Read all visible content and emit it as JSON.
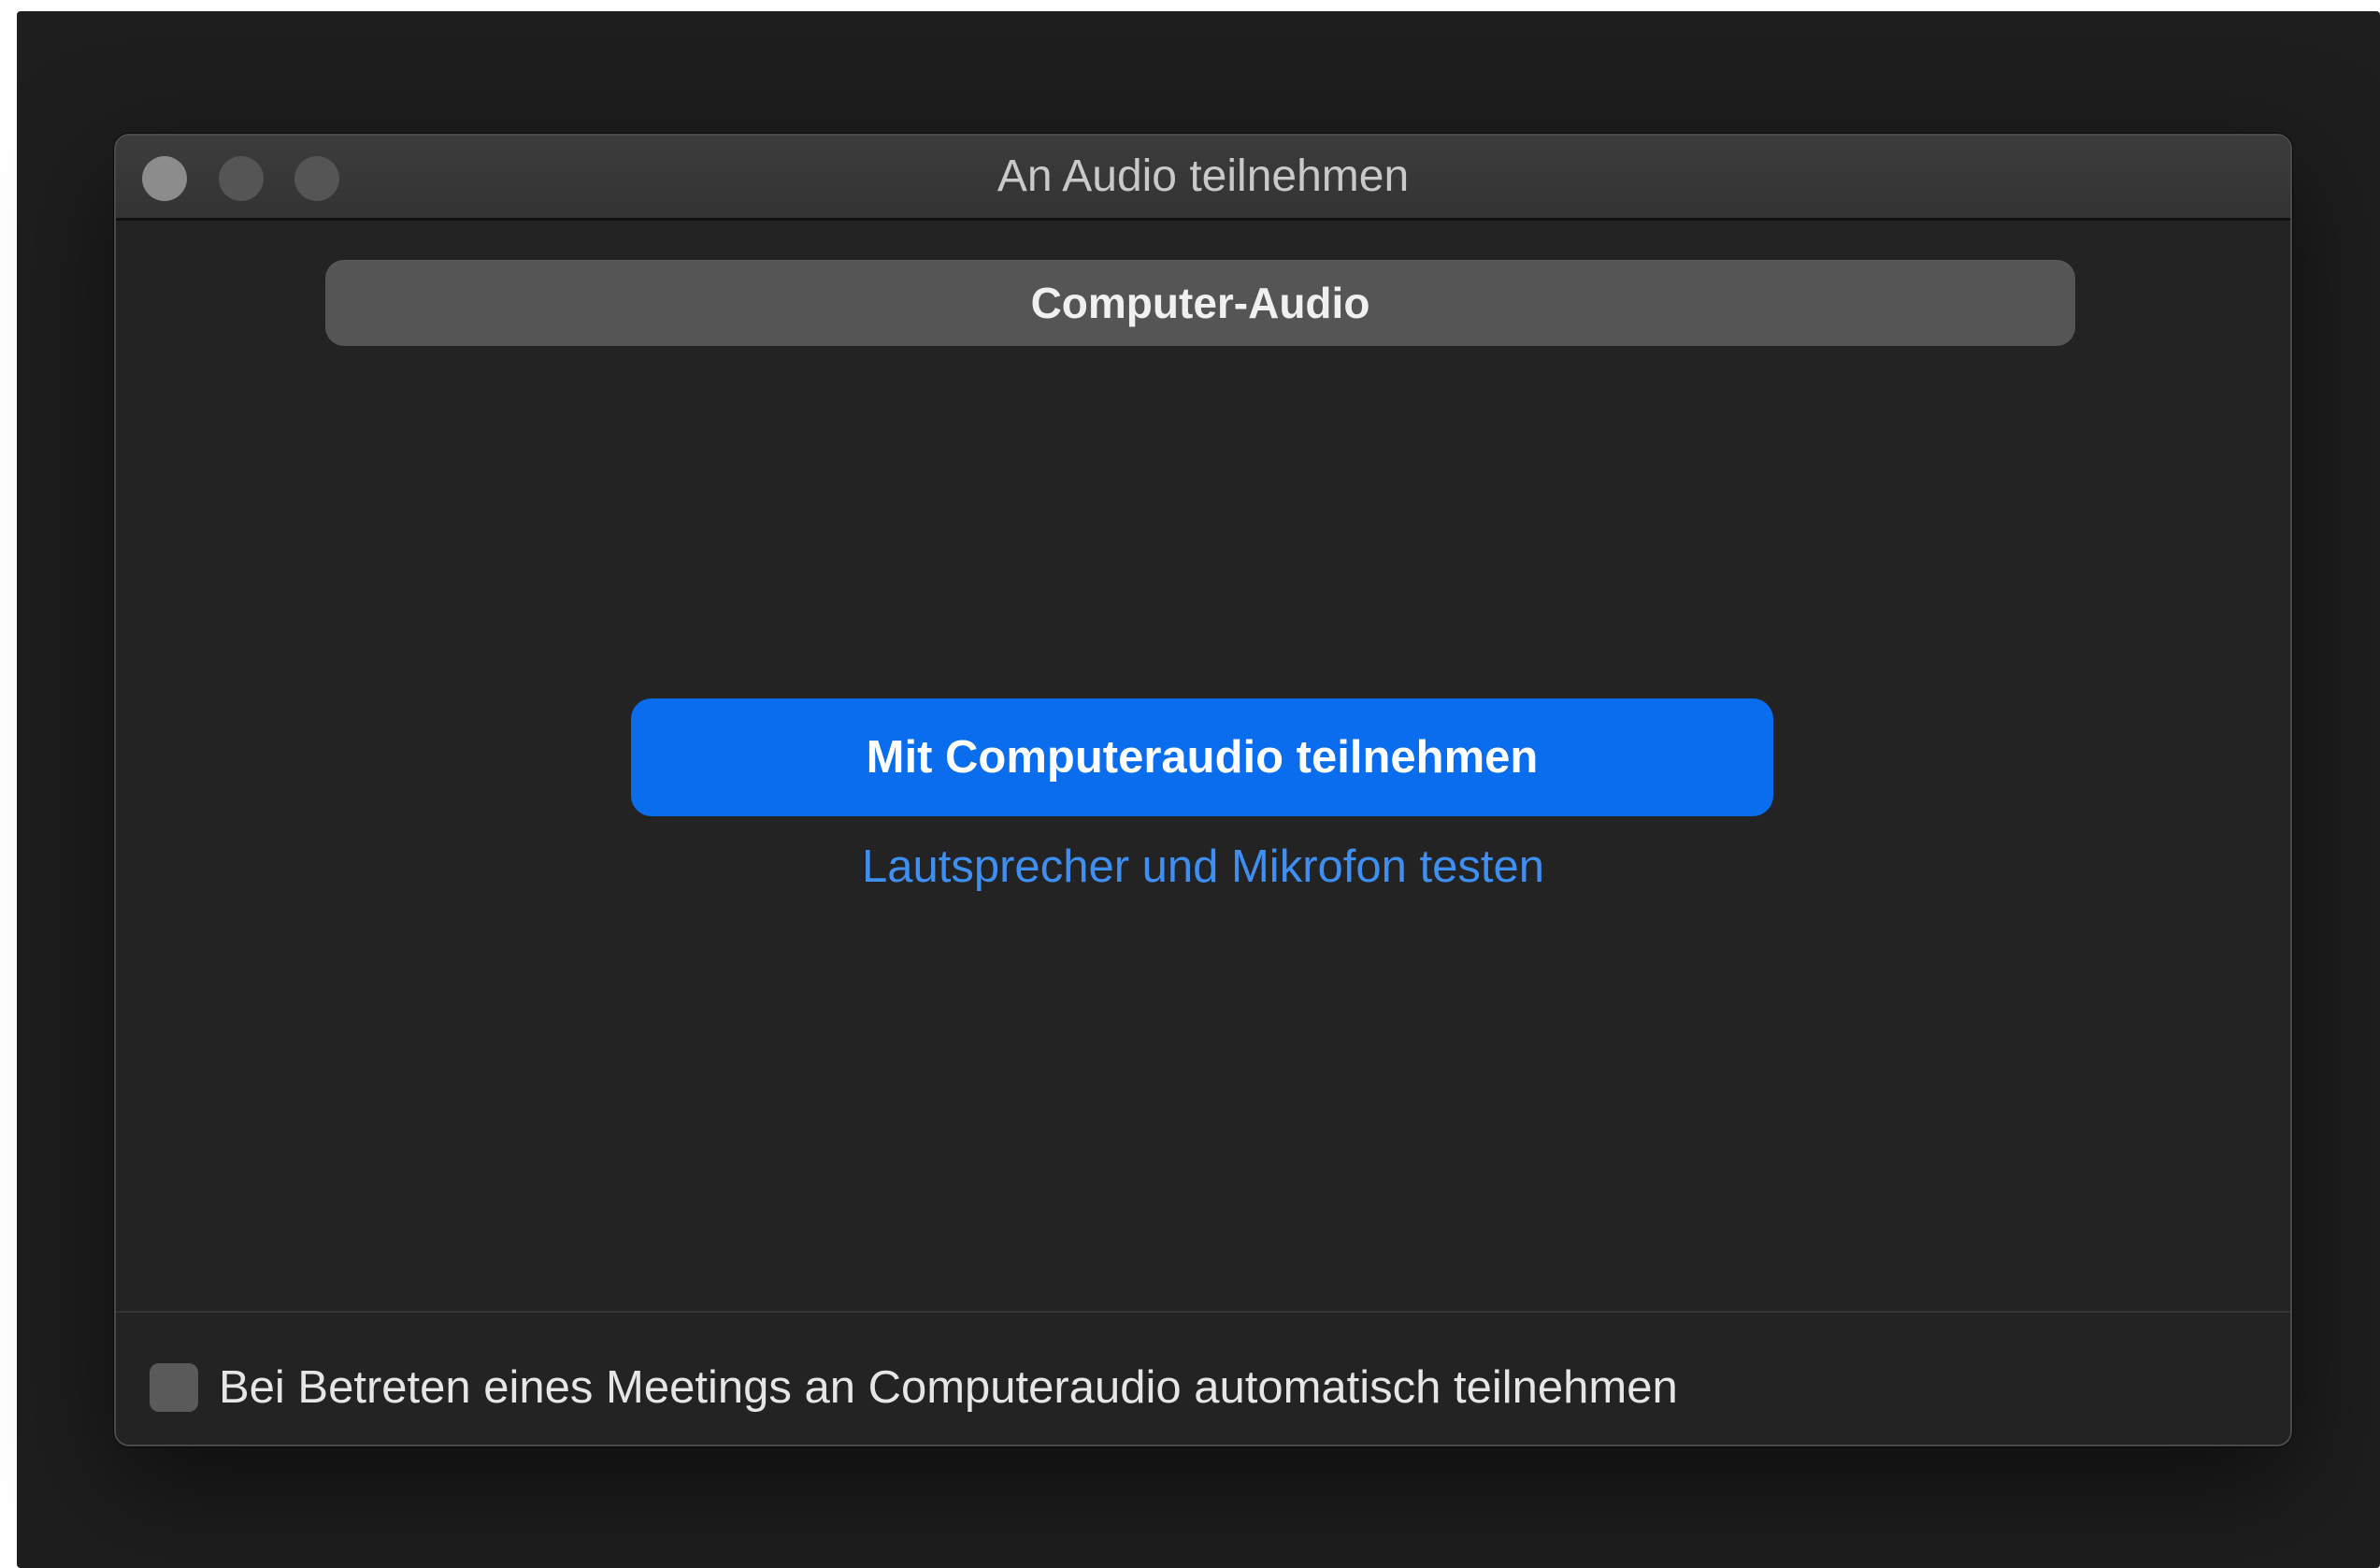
{
  "window": {
    "title": "An Audio teilnehmen"
  },
  "tabs": {
    "selected_label": "Computer-Audio"
  },
  "main": {
    "join_button_label": "Mit Computeraudio teilnehmen",
    "test_link_label": "Lautsprecher und Mikrofon testen"
  },
  "footer": {
    "auto_join_checked": false,
    "auto_join_label": "Bei Betreten eines Meetings an Computeraudio automatisch teilnehmen"
  },
  "colors": {
    "accent": "#0a6dee",
    "link": "#3f8ff3",
    "window_bg": "#232323"
  }
}
